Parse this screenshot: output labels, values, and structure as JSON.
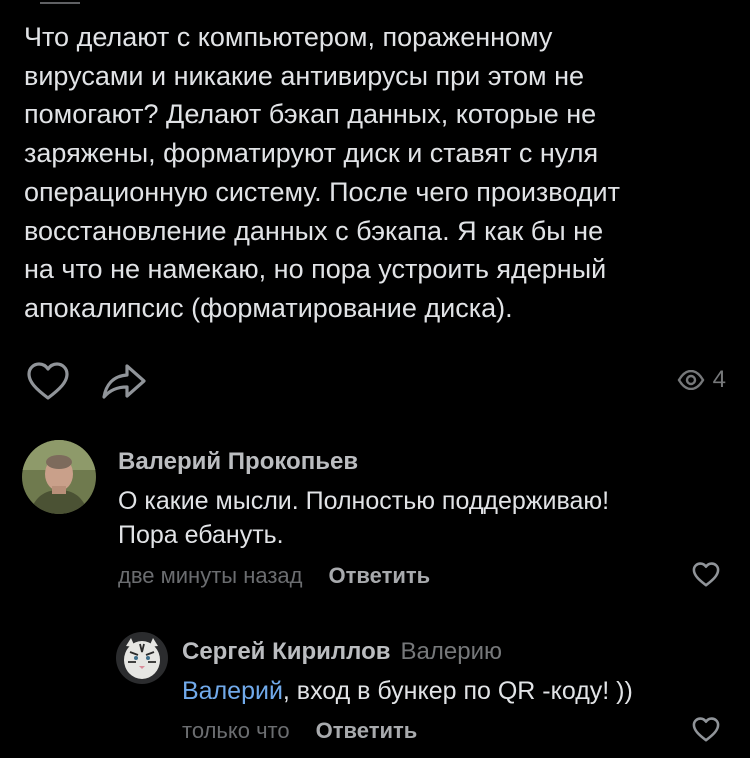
{
  "post": {
    "text": "Что делают с компьютером, пораженному\nвирусами и никакие антивирусы при этом не\nпомогают? Делают бэкап данных, которые не\nзаряжены, форматируют диск и ставят с нуля\nоперационную систему. После чего производит\nвосстановление данных с бэкапа. Я как бы не\nна что не намекаю, но пора устроить ядерный\nапокалипсис (форматирование диска).",
    "views_count": "4",
    "icons": {
      "like": "heart-icon",
      "share": "share-arrow-icon",
      "views": "eye-icon"
    }
  },
  "comments": [
    {
      "author": "Валерий Прокопьев",
      "text_lines": [
        "О какие мысли. Полностью поддерживаю!",
        "Пора ебануть."
      ],
      "time": "две минуты назад",
      "reply_label": "Ответить",
      "avatar": "user-photo-avatar"
    },
    {
      "author": "Сергей Кириллов",
      "reply_to": "Валерию",
      "mention": "Валерий",
      "text_rest": ", вход в бункер по QR -коду! ))",
      "time": "только что",
      "reply_label": "Ответить",
      "avatar": "white-tiger-avatar"
    }
  ],
  "colors": {
    "background": "#000000",
    "text": "#e1e3e6",
    "secondary": "#76787a",
    "mention": "#71aaeb"
  }
}
